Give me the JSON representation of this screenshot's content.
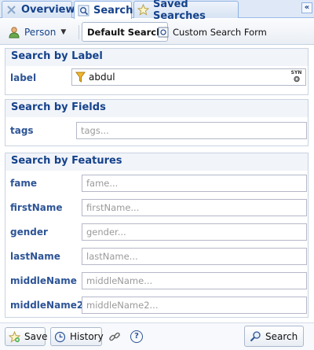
{
  "tabs": [
    {
      "label": "Overview",
      "icon": "overview-icon"
    },
    {
      "label": "Search",
      "icon": "search-icon"
    },
    {
      "label": "Saved Searches",
      "icon": "star-icon"
    }
  ],
  "collapse": {
    "glyph": "«"
  },
  "toolbar": {
    "type_label": "Person",
    "default_search": "Default Search",
    "custom_search_form": "Custom Search Form"
  },
  "search_by_label": {
    "title": "Search by Label",
    "field_label": "label",
    "value": "abdul",
    "syn": "SYN"
  },
  "search_by_fields": {
    "title": "Search by Fields",
    "tags_label": "tags",
    "tags_placeholder": "tags..."
  },
  "search_by_features": {
    "title": "Search by Features",
    "fields": [
      {
        "label": "fame",
        "placeholder": "fame..."
      },
      {
        "label": "firstName",
        "placeholder": "firstName..."
      },
      {
        "label": "gender",
        "placeholder": "gender..."
      },
      {
        "label": "lastName",
        "placeholder": "lastName..."
      },
      {
        "label": "middleName",
        "placeholder": "middleName..."
      },
      {
        "label": "middleName2",
        "placeholder": "middleName2..."
      }
    ]
  },
  "footer": {
    "save": "Save",
    "history": "History",
    "help": "?",
    "search": "Search"
  }
}
